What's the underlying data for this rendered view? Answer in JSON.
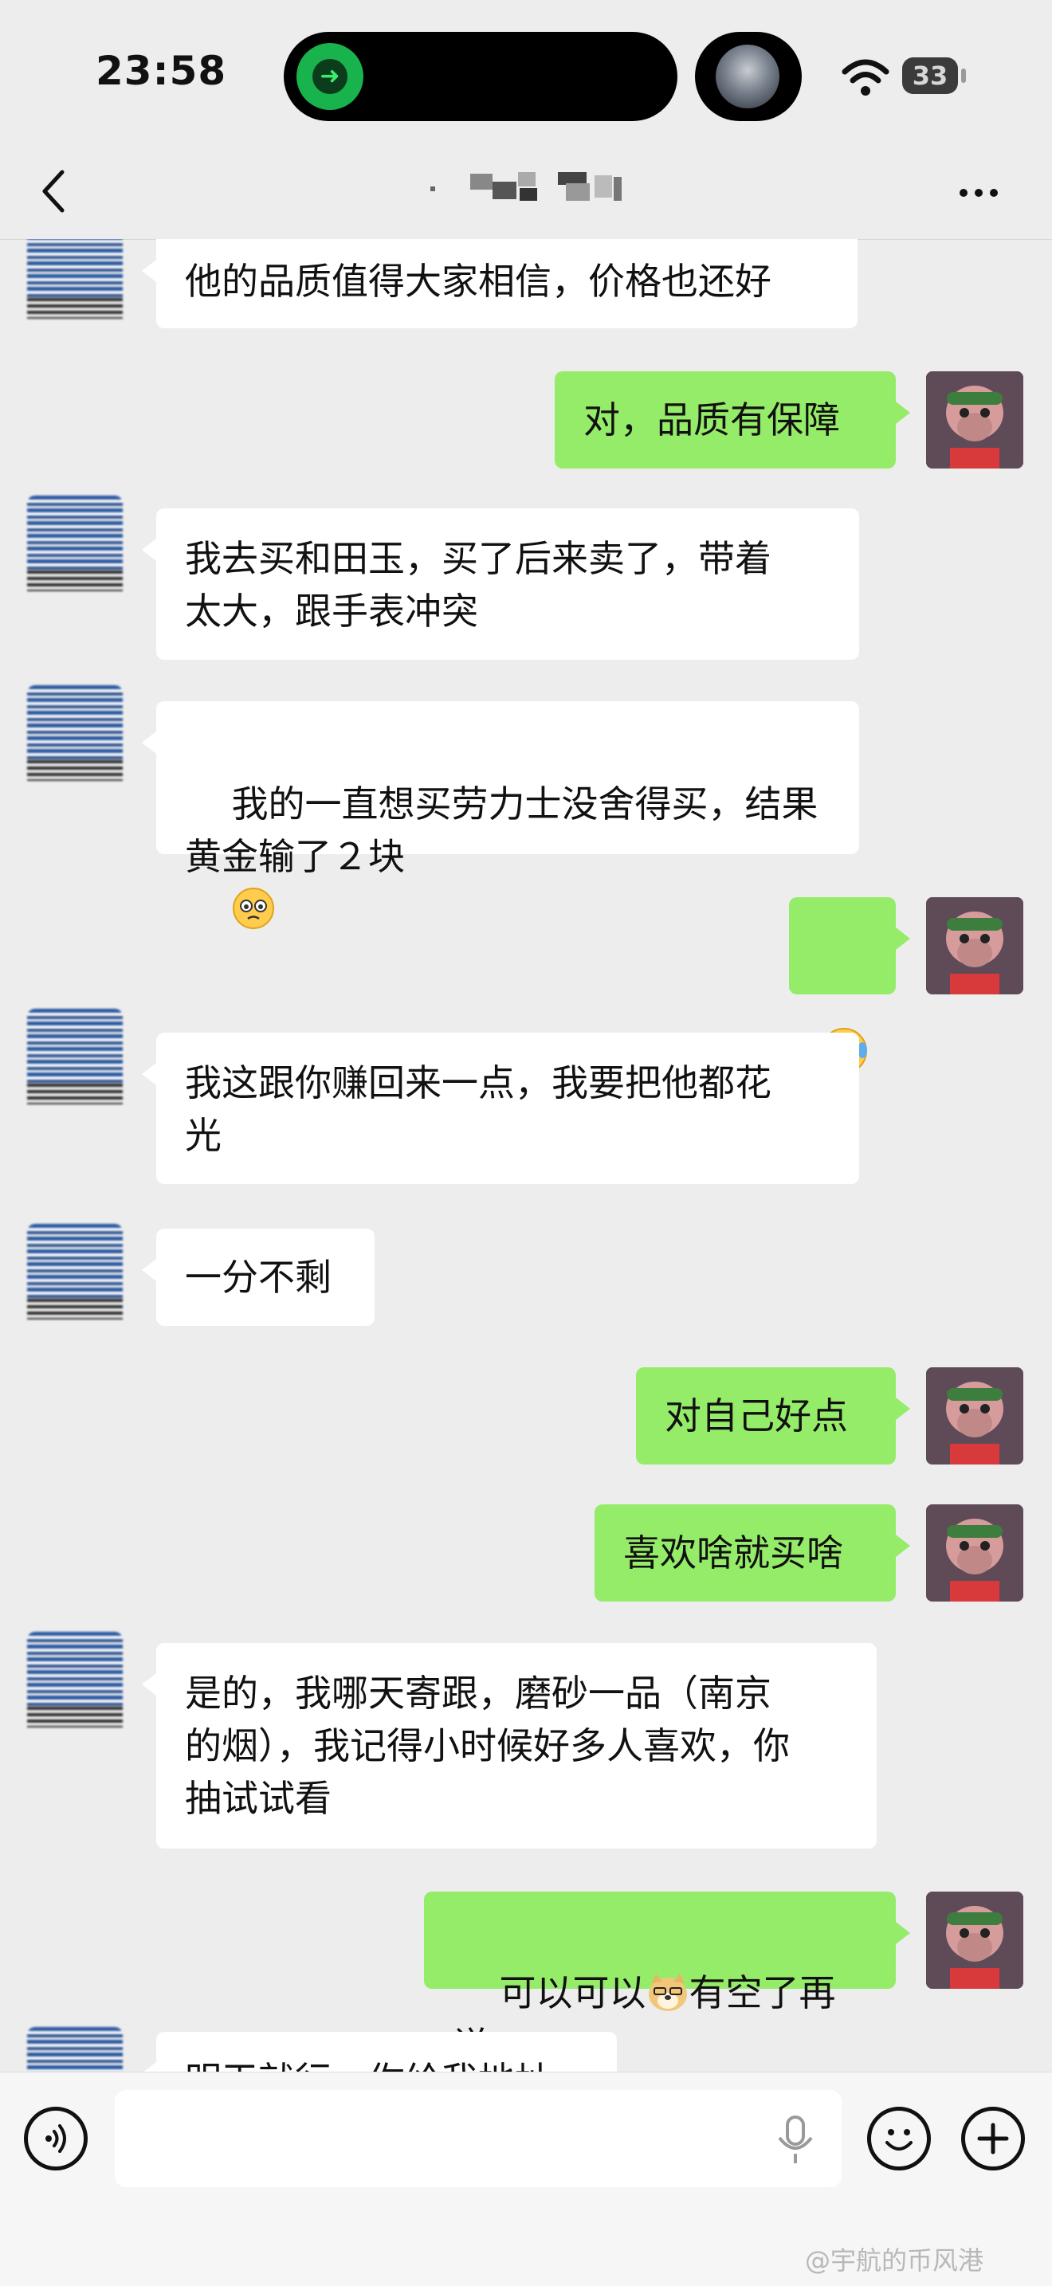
{
  "status_bar": {
    "time": "23:58",
    "battery": "33"
  },
  "nav": {
    "title_blurred": true,
    "back_icon": "chevron-left-icon",
    "more_icon": "more-dots-icon"
  },
  "messages": [
    {
      "side": "left",
      "text": "他的品质值得大家相信，价格也还好"
    },
    {
      "side": "right",
      "text": "对，品质有保障"
    },
    {
      "side": "left",
      "text": "我去买和田玉，买了后来卖了，带着\n太大，跟手表冲突"
    },
    {
      "side": "left",
      "text": "我的一直想买劳力士没舍得买，结果\n黄金输了２块",
      "emoji": "pleading-face-emoji"
    },
    {
      "side": "right",
      "text": "",
      "emoji": "laughing-crying-face-emoji"
    },
    {
      "side": "left",
      "text": "我这跟你赚回来一点，我要把他都花\n光"
    },
    {
      "side": "left",
      "text": "一分不剩"
    },
    {
      "side": "right",
      "text": "对自己好点"
    },
    {
      "side": "right",
      "text": "喜欢啥就买啥"
    },
    {
      "side": "left",
      "text": "是的，我哪天寄跟，磨砂一品（南京\n的烟），我记得小时候好多人喜欢，你\n抽试试看"
    },
    {
      "side": "right",
      "text_before": "可以可以",
      "emoji": "doge-emoji",
      "text_after": "有空了再说"
    },
    {
      "side": "left",
      "text": "明天就行，你给我地址"
    }
  ],
  "input_bar": {
    "voice_icon": "voice-icon",
    "mic_icon": "microphone-icon",
    "emoji_icon": "smiley-face-icon",
    "plus_icon": "plus-icon"
  },
  "watermark": "@宇航的币风港",
  "colors": {
    "background": "#ededed",
    "bubble_right": "#95ec69",
    "bubble_left": "#ffffff"
  }
}
